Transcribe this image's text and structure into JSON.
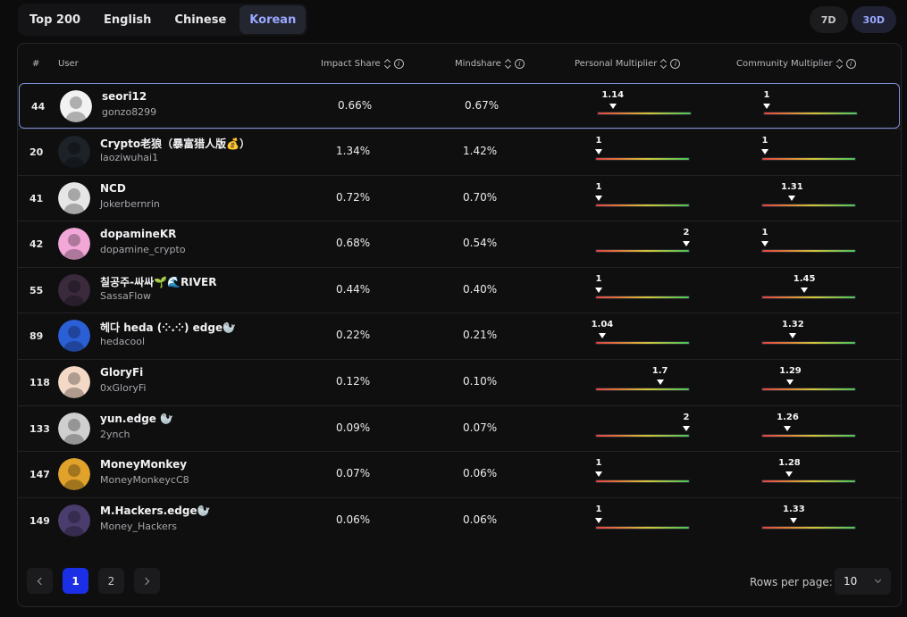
{
  "tabs": [
    "Top 200",
    "English",
    "Chinese",
    "Korean"
  ],
  "active_tab": "Korean",
  "period": [
    "7D",
    "30D"
  ],
  "active_period": "30D",
  "columns": {
    "rank": "#",
    "user": "User",
    "impact": "Impact Share",
    "mind": "Mindshare",
    "personal": "Personal Multiplier",
    "community": "Community Multiplier"
  },
  "multiplier_range": [
    1,
    2
  ],
  "rows": [
    {
      "rank": "44",
      "name": "seori12",
      "handle": "gonzo8299",
      "impact": "0.66%",
      "mind": "0.67%",
      "pm": 1.14,
      "pm_label": "1.14",
      "cm": 1,
      "cm_label": "1",
      "avatar_color": "#f2f2f2",
      "selected": true
    },
    {
      "rank": "20",
      "name": "Crypto老狼（暴富猎人版💰）",
      "handle": "laoziwuhai1",
      "impact": "1.34%",
      "mind": "1.42%",
      "pm": 1,
      "pm_label": "1",
      "cm": 1,
      "cm_label": "1",
      "avatar_color": "#1c2228"
    },
    {
      "rank": "41",
      "name": "NCD",
      "handle": "Jokerbernrin",
      "impact": "0.72%",
      "mind": "0.70%",
      "pm": 1,
      "pm_label": "1",
      "cm": 1.31,
      "cm_label": "1.31",
      "avatar_color": "#e6e6e6"
    },
    {
      "rank": "42",
      "name": "dopamineKR",
      "handle": "dopamine_crypto",
      "impact": "0.68%",
      "mind": "0.54%",
      "pm": 2,
      "pm_label": "2",
      "cm": 1,
      "cm_label": "1",
      "avatar_color": "#f2a7d8"
    },
    {
      "rank": "55",
      "name": "칠공주-싸싸🌱🌊RIVER",
      "handle": "SassaFlow",
      "impact": "0.44%",
      "mind": "0.40%",
      "pm": 1,
      "pm_label": "1",
      "cm": 1.45,
      "cm_label": "1.45",
      "avatar_color": "#3a2a3c"
    },
    {
      "rank": "89",
      "name": "헤다 heda (⁘.⁘) edge🦭",
      "handle": "hedacool",
      "impact": "0.22%",
      "mind": "0.21%",
      "pm": 1.04,
      "pm_label": "1.04",
      "cm": 1.32,
      "cm_label": "1.32",
      "avatar_color": "#2b5fd6"
    },
    {
      "rank": "118",
      "name": "GloryFi",
      "handle": "0xGloryFi",
      "impact": "0.12%",
      "mind": "0.10%",
      "pm": 1.7,
      "pm_label": "1.7",
      "cm": 1.29,
      "cm_label": "1.29",
      "avatar_color": "#f4d9c6"
    },
    {
      "rank": "133",
      "name": "yun.edge 🦭",
      "handle": "2ynch",
      "impact": "0.09%",
      "mind": "0.07%",
      "pm": 2,
      "pm_label": "2",
      "cm": 1.26,
      "cm_label": "1.26",
      "avatar_color": "#cfcfcf"
    },
    {
      "rank": "147",
      "name": "MoneyMonkey",
      "handle": "MoneyMonkeycC8",
      "impact": "0.07%",
      "mind": "0.06%",
      "pm": 1,
      "pm_label": "1",
      "cm": 1.28,
      "cm_label": "1.28",
      "avatar_color": "#e0a22a"
    },
    {
      "rank": "149",
      "name": "M.Hackers.edge🦭",
      "handle": "Money_Hackers",
      "impact": "0.06%",
      "mind": "0.06%",
      "pm": 1,
      "pm_label": "1",
      "cm": 1.33,
      "cm_label": "1.33",
      "avatar_color": "#4a3d6e"
    }
  ],
  "pagination": {
    "pages": [
      "1",
      "2"
    ],
    "current": "1"
  },
  "rows_per_page": {
    "label": "Rows per page:",
    "value": "10"
  },
  "colors": {
    "accent": "#9aa7ff",
    "page_active": "#1a2fe6",
    "selected_border": "#7f8fd6"
  }
}
